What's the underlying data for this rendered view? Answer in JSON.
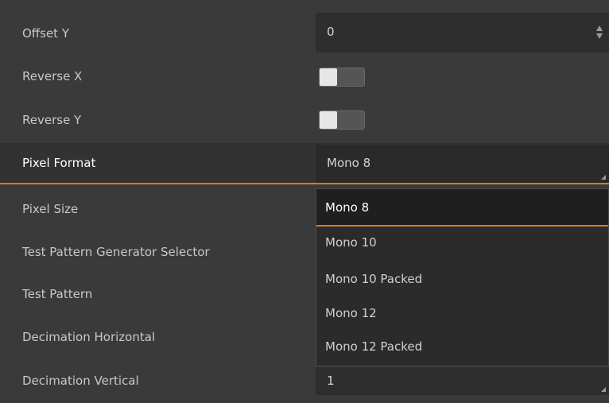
{
  "properties": {
    "offset_y": {
      "label": "Offset Y",
      "value": "0"
    },
    "reverse_x": {
      "label": "Reverse X",
      "on": false
    },
    "reverse_y": {
      "label": "Reverse Y",
      "on": false
    },
    "pixel_format": {
      "label": "Pixel Format",
      "value": "Mono 8"
    },
    "pixel_size": {
      "label": "Pixel Size"
    },
    "test_pattern_generator_selector": {
      "label": "Test Pattern Generator Selector"
    },
    "test_pattern": {
      "label": "Test Pattern"
    },
    "decimation_horizontal": {
      "label": "Decimation Horizontal"
    },
    "decimation_vertical": {
      "label": "Decimation Vertical",
      "value": "1"
    }
  },
  "pixel_format_dropdown": {
    "options": [
      "Mono 8",
      "Mono 10",
      "Mono 10 Packed",
      "Mono 12",
      "Mono 12 Packed"
    ],
    "selected": "Mono 8"
  },
  "colors": {
    "background": "#3a3a3a",
    "field": "#2e2e2e",
    "accent": "#e0781c"
  },
  "icons": [
    "spinner-arrows-icon",
    "toggle-switch",
    "dropdown-corner-icon"
  ]
}
